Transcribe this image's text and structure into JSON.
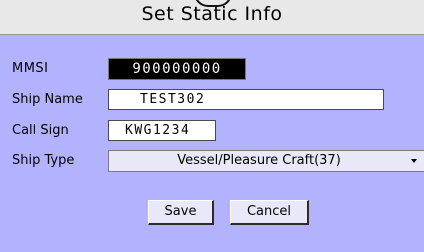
{
  "window": {
    "title": "Set Static Info"
  },
  "form": {
    "mmsi": {
      "label": "MMSI",
      "value": "900000000"
    },
    "ship_name": {
      "label": "Ship Name",
      "value": "TEST302"
    },
    "call_sign": {
      "label": "Call Sign",
      "value": "KWG1234"
    },
    "ship_type": {
      "label": "Ship Type",
      "value": "Vessel/Pleasure Craft(37)"
    }
  },
  "buttons": {
    "save": "Save",
    "cancel": "Cancel"
  },
  "colors": {
    "background": "#b3b2ff",
    "title_bar": "#e8e8e8",
    "mmsi_box": "#000000"
  },
  "icons": {
    "ship_type_dropdown": "chevron-down-icon"
  }
}
